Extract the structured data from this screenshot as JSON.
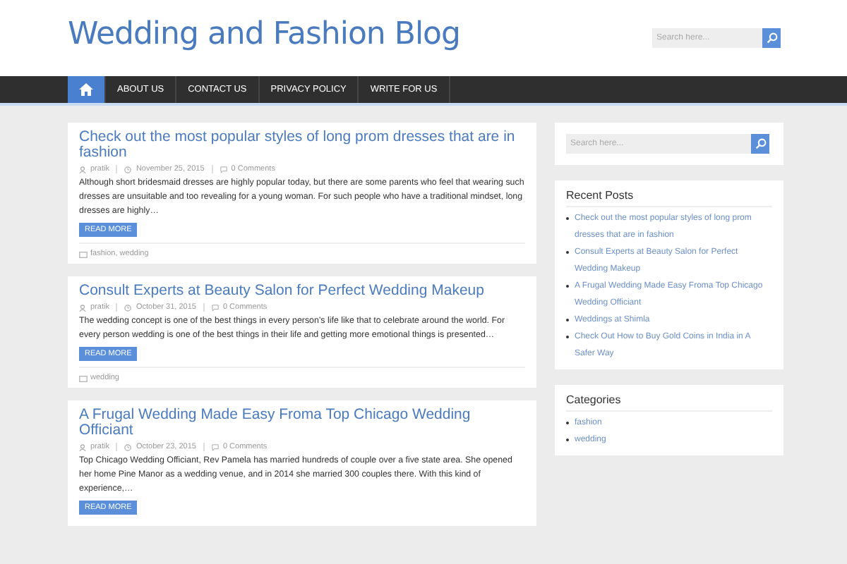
{
  "site_title": "Wedding and Fashion Blog",
  "header_search": {
    "placeholder": "Search here..."
  },
  "nav": {
    "items": [
      {
        "kind": "home",
        "selected": true
      },
      {
        "kind": "text",
        "label": "ABOUT US",
        "selected": false
      },
      {
        "kind": "text",
        "label": "CONTACT US",
        "selected": false
      },
      {
        "kind": "text",
        "label": "PRIVACY POLICY",
        "selected": false
      },
      {
        "kind": "text",
        "label": "WRITE FOR US",
        "selected": false
      }
    ]
  },
  "posts": [
    {
      "title": "Check out the most popular styles of long prom dresses that are in fashion",
      "author": "pratik",
      "date": "November 25, 2015",
      "comments": "0 Comments",
      "excerpt": "Although short bridesmaid dresses are highly popular today, but there are some parents who feel that wearing such dresses are unsuitable and too revealing for a young woman. For such people who have a traditional mindset, long dresses are highly…",
      "button": "READ MORE",
      "categories": "fashion, wedding"
    },
    {
      "title": "Consult Experts at Beauty Salon for Perfect Wedding Makeup",
      "author": "pratik",
      "date": "October 31, 2015",
      "comments": "0 Comments",
      "excerpt": "The wedding concept is one of the best things in every person’s life like that to celebrate around the world. For every person wedding is one of the best things in their life and getting more emotional things is presented…",
      "button": "READ MORE",
      "categories": "wedding"
    },
    {
      "title": "A Frugal Wedding Made Easy Froma Top Chicago Wedding Officiant",
      "author": "pratik",
      "date": "October 23, 2015",
      "comments": "0 Comments",
      "excerpt": "  Top Chicago Wedding Officiant, Rev Pamela has married hundreds of couple over a five state area. She opened her home Pine Manor as a wedding venue, and in 2014 she married 300 couples there. With this kind of experience,…",
      "button": "READ MORE"
    }
  ],
  "sidebar": {
    "search": {
      "placeholder": "Search here..."
    },
    "recent_posts": {
      "title": "Recent Posts",
      "items": [
        "Check out the most popular styles of long prom dresses that are in fashion",
        "Consult Experts at Beauty Salon for Perfect Wedding Makeup",
        "A Frugal Wedding Made Easy Froma Top Chicago Wedding Officiant",
        "Weddings at Shimla",
        "Check Out How to Buy Gold Coins in India in A Safer Way"
      ]
    },
    "categories": {
      "title": "Categories",
      "items": [
        "fashion",
        "wedding"
      ]
    }
  }
}
